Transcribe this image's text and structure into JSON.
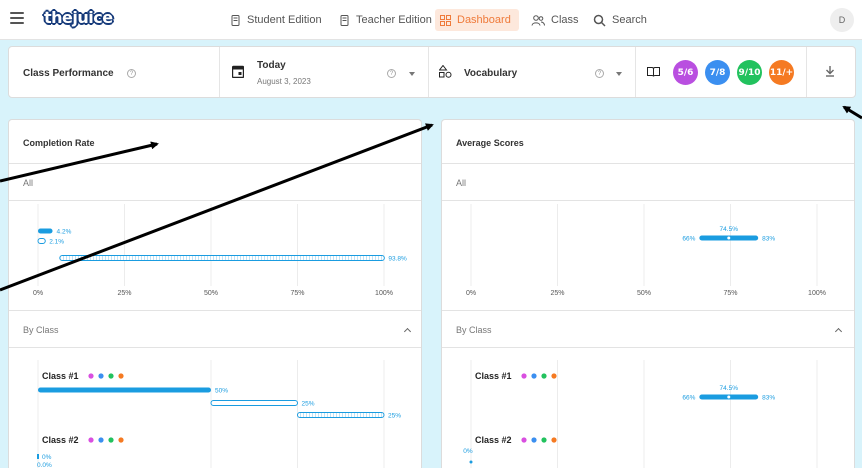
{
  "app": {
    "logo_text": "thejuice",
    "nav": [
      {
        "label": "Student Edition",
        "icon": "tablet-icon"
      },
      {
        "label": "Teacher Edition",
        "icon": "tablet-icon"
      },
      {
        "label": "Dashboard",
        "icon": "grid-icon",
        "active": true
      },
      {
        "label": "Class",
        "icon": "people-icon"
      },
      {
        "label": "Search",
        "icon": "search-icon"
      }
    ],
    "avatar_initial": "D"
  },
  "filters": {
    "section_label": "Class Performance",
    "date_label": "Today",
    "date_value": "August 3, 2023",
    "metric_label": "Vocabulary",
    "grade_badges": [
      {
        "label": "5/6",
        "color": "#b94fe0"
      },
      {
        "label": "7/8",
        "color": "#3b8ff0"
      },
      {
        "label": "9/10",
        "color": "#22c25e"
      },
      {
        "label": "11/+",
        "color": "#f57a22"
      }
    ]
  },
  "colors": {
    "accent": "#1a9ce0",
    "active_nav": "#ef7a3a",
    "arrow": "#000000"
  },
  "completion": {
    "title": "Completion Rate",
    "all_label": "All",
    "by_class_label": "By Class",
    "axis_ticks": [
      "0%",
      "25%",
      "50%",
      "75%",
      "100%"
    ],
    "all_bars": [
      {
        "value": 4.2,
        "label": "4.2%",
        "style": "solid"
      },
      {
        "value": 2.1,
        "label": "2.1%",
        "style": "outline"
      },
      {
        "value": 93.8,
        "label": "93.8%",
        "style": "hatched",
        "start": 6.3
      }
    ],
    "classes": [
      {
        "name": "Class #1",
        "dots": [
          "#d94fe0",
          "#3b8ff0",
          "#22c25e",
          "#f57a22"
        ],
        "bars": [
          {
            "start": 0,
            "value": 50,
            "label": "50%",
            "style": "solid"
          },
          {
            "start": 50,
            "value": 25,
            "label": "25%",
            "style": "outline"
          },
          {
            "start": 75,
            "value": 25,
            "label": "25%",
            "style": "hatched"
          }
        ]
      },
      {
        "name": "Class #2",
        "dots": [
          "#d94fe0",
          "#3b8ff0",
          "#22c25e",
          "#f57a22"
        ],
        "bars": [
          {
            "start": 0,
            "value": 0,
            "label": "0%",
            "style": "solid"
          },
          {
            "start": 0,
            "value": 0,
            "label": "0.0%",
            "style": "outline"
          }
        ]
      }
    ]
  },
  "average": {
    "title": "Average Scores",
    "all_label": "All",
    "by_class_label": "By Class",
    "axis_ticks": [
      "0%",
      "25%",
      "50%",
      "75%",
      "100%"
    ],
    "all_range": {
      "min": 66,
      "mean": 74.5,
      "max": 83,
      "min_label": "66%",
      "mean_label": "74.5%",
      "max_label": "83%"
    },
    "classes": [
      {
        "name": "Class #1",
        "dots": [
          "#d94fe0",
          "#3b8ff0",
          "#22c25e",
          "#f57a22"
        ],
        "range": {
          "min": 66,
          "mean": 74.5,
          "max": 83,
          "min_label": "66%",
          "mean_label": "74.5%",
          "max_label": "83%"
        }
      },
      {
        "name": "Class #2",
        "dots": [
          "#d94fe0",
          "#3b8ff0",
          "#22c25e",
          "#f57a22"
        ],
        "range": {
          "min": 0,
          "mean": 0,
          "max": 0,
          "min_label": "0%",
          "mean_label": "",
          "max_label": ""
        }
      }
    ]
  }
}
